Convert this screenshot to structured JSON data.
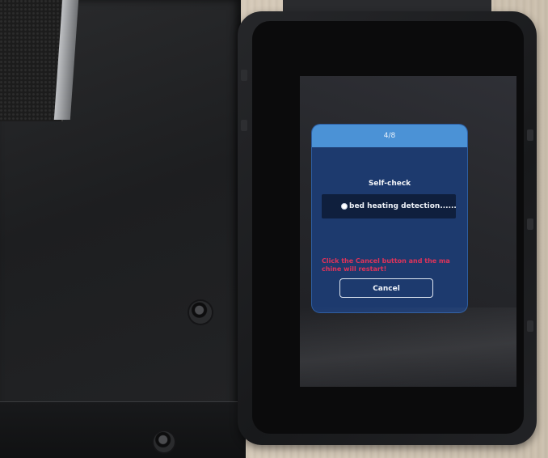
{
  "dialog": {
    "step": "4/8",
    "title": "Self-check",
    "status_text": "bed heating detection......",
    "warning_line_1": "Click the Cancel button and the ma",
    "warning_line_2": "chine will restart!",
    "cancel_label": "Cancel"
  },
  "colors": {
    "dialog_header": "#4b92d6",
    "dialog_body": "#1d3a6e",
    "warning_text": "#e0335a"
  },
  "icons": {
    "status_indicator": "spinner-icon"
  }
}
